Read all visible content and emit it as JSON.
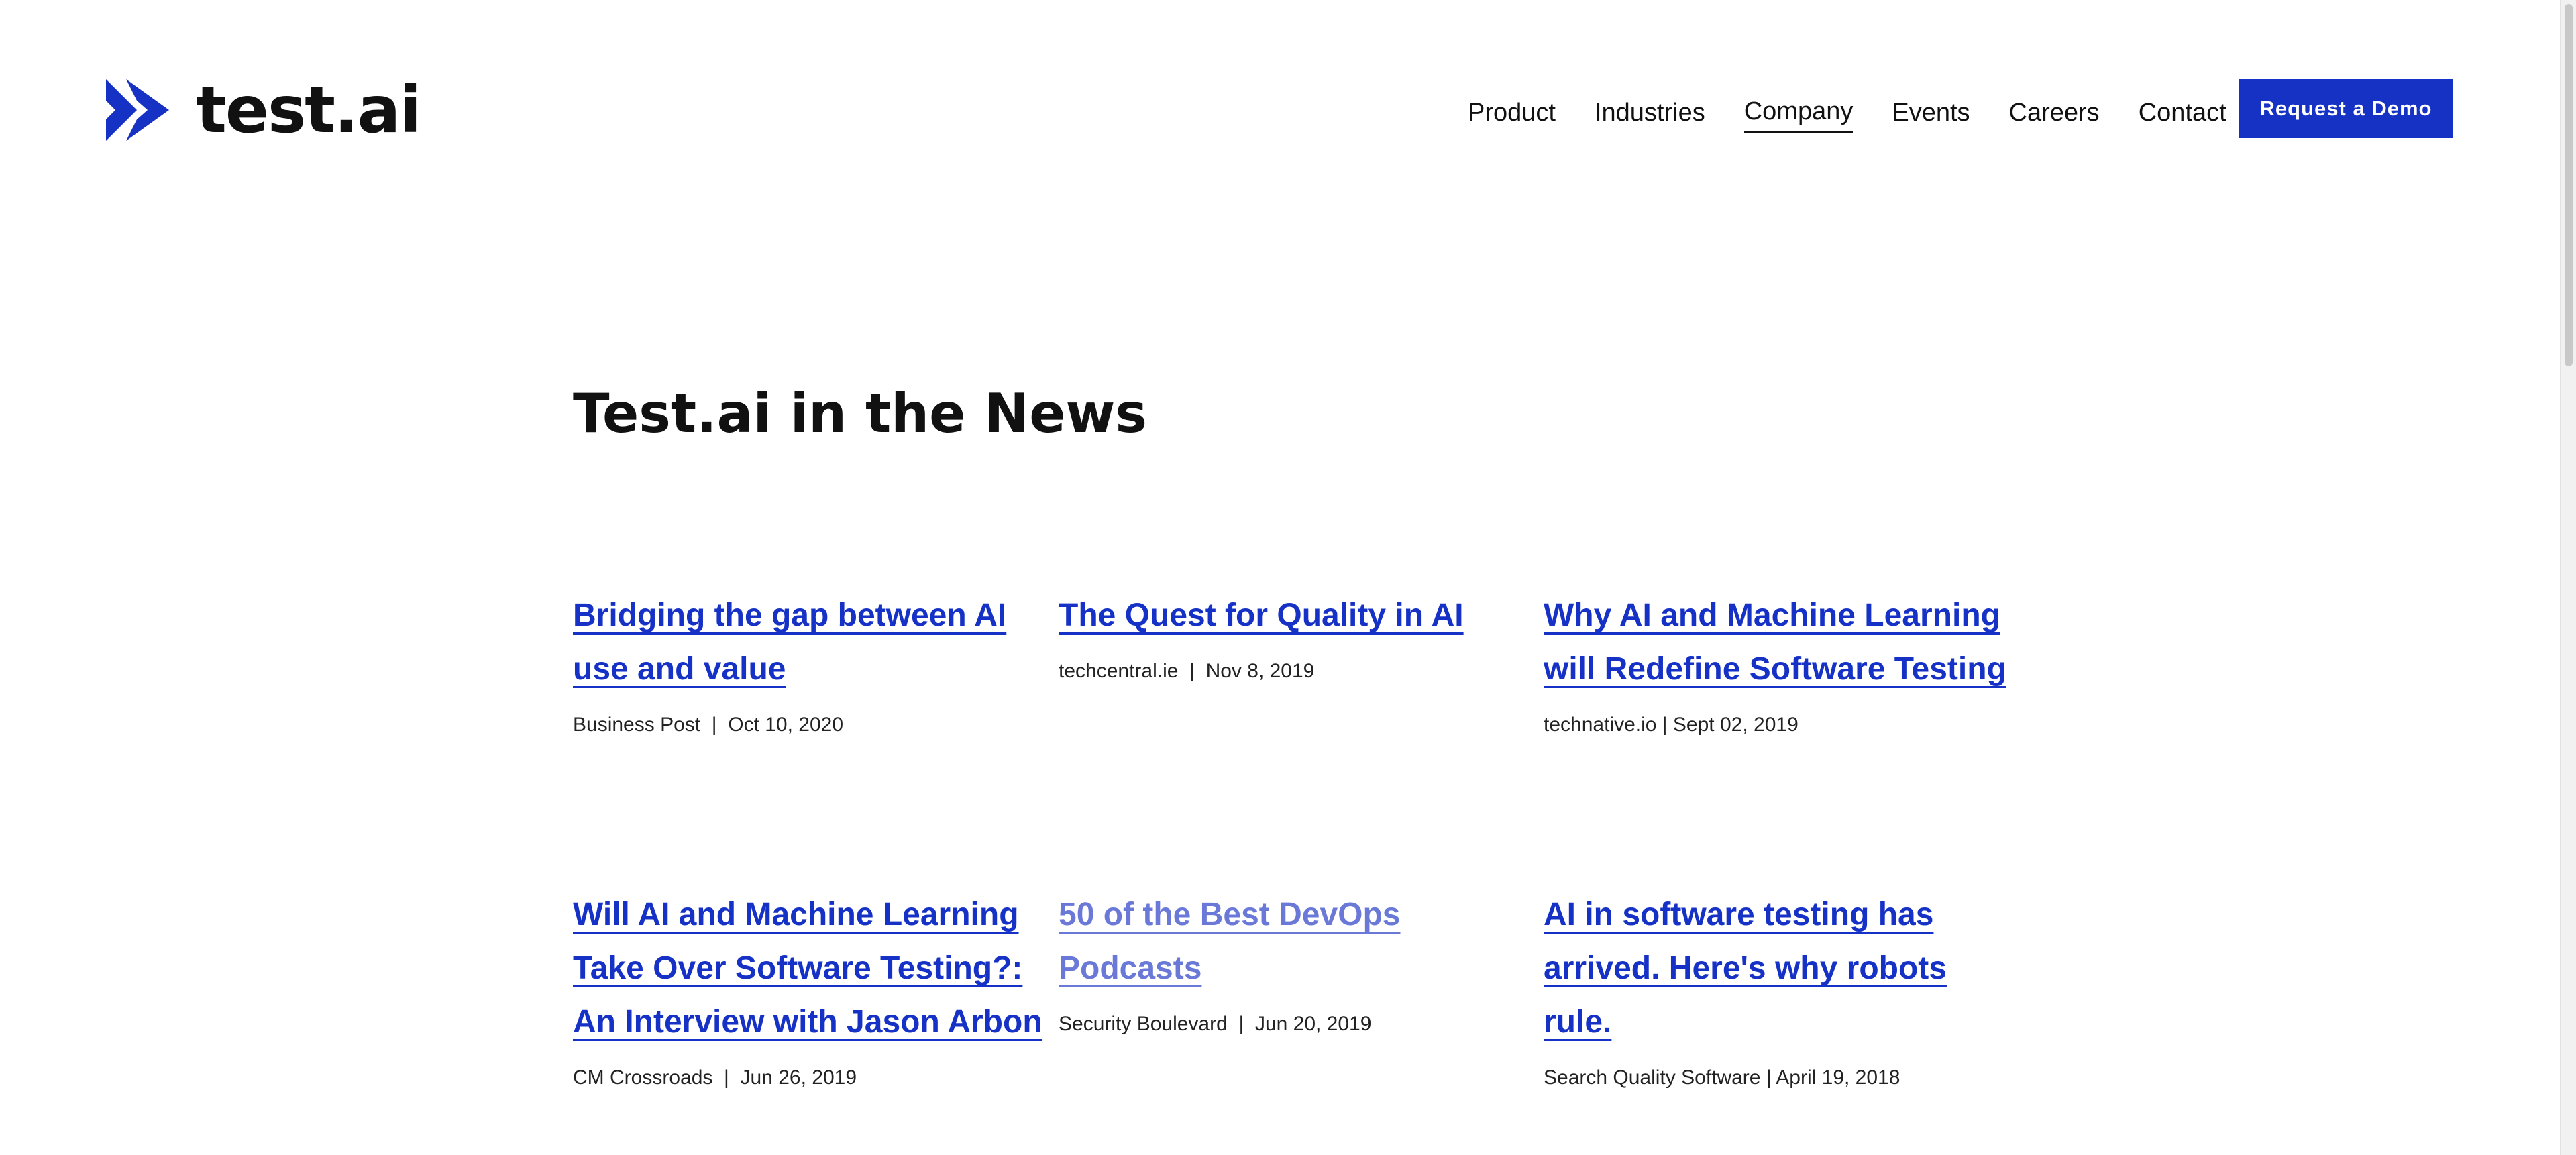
{
  "brand": {
    "name": "test.ai",
    "accent_color": "#1632c4",
    "logo_icon": "double-chevron-logo-icon"
  },
  "nav": {
    "items": [
      {
        "label": "Product",
        "active": false
      },
      {
        "label": "Industries",
        "active": false
      },
      {
        "label": "Company",
        "active": true
      },
      {
        "label": "Events",
        "active": false
      },
      {
        "label": "Careers",
        "active": false
      },
      {
        "label": "Contact",
        "active": false
      }
    ],
    "cta_label": "Request a Demo"
  },
  "main": {
    "heading": "Test.ai in the News",
    "articles": [
      {
        "title": "Bridging the gap between AI use and value",
        "source": "Business Post",
        "separator": "  |  ",
        "date": "Oct 10, 2020"
      },
      {
        "title": "The Quest for Quality in AI",
        "source": "techcentral.ie",
        "separator": "  |  ",
        "date": "Nov 8, 2019"
      },
      {
        "title": "Why AI and Machine Learning will Redefine Software Testing",
        "source": "technative.io",
        "separator": " | ",
        "date": "Sept 02, 2019"
      },
      {
        "title": "Will AI and Machine Learning Take Over Software Testing?: An Interview with Jason Arbon",
        "source": "CM Crossroads",
        "separator": "  |  ",
        "date": "Jun 26, 2019"
      },
      {
        "title": "50 of the Best DevOps Podcasts",
        "source": "Security Boulevard",
        "separator": "  |  ",
        "date": "Jun 20, 2019"
      },
      {
        "title": "AI in software testing has arrived. Here's why robots rule.",
        "source": "Search Quality Software",
        "separator": " | ",
        "date": "April 19, 2018"
      }
    ]
  }
}
